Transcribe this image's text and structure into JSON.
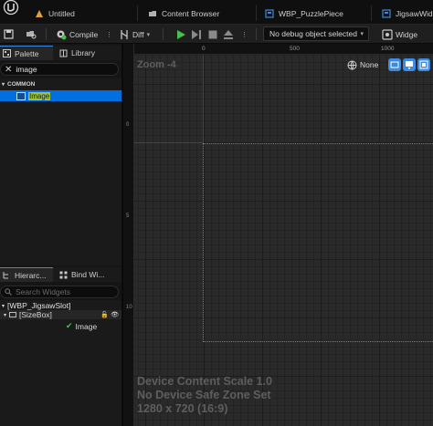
{
  "tabs": [
    {
      "label": "Untitled"
    },
    {
      "label": "Content Browser"
    },
    {
      "label": "WBP_PuzzlePiece"
    },
    {
      "label": "JigsawWid"
    }
  ],
  "toolbar": {
    "compile_label": "Compile",
    "diff_label": "Diff",
    "debug_object": "No debug object selected",
    "widget_label": "Widge"
  },
  "palette": {
    "tab_palette": "Palette",
    "tab_library": "Library",
    "search_value": "image",
    "category": "COMMON",
    "item": "Image"
  },
  "hierarchy": {
    "tab_hierarchy": "Hierarc...",
    "tab_bind": "Bind Wi...",
    "search_placeholder": "Search Widgets",
    "root": "[WBP_JigsawSlot]",
    "sizebox": "[SizeBox]",
    "image": "Image"
  },
  "viewport": {
    "zoom": "Zoom -4",
    "none_label": "None",
    "ruler_top": [
      "0",
      "500",
      "1000"
    ],
    "ruler_left": [
      "0",
      "5",
      "10"
    ],
    "info_line1": "Device Content Scale 1.0",
    "info_line2": "No Device Safe Zone Set",
    "info_line3": "1280 x 720 (16:9)"
  },
  "colors": {
    "accent": "#3b8ce0",
    "selection": "#0070e0",
    "highlight_text": "#c8e23a",
    "play_green": "#48c04a"
  }
}
